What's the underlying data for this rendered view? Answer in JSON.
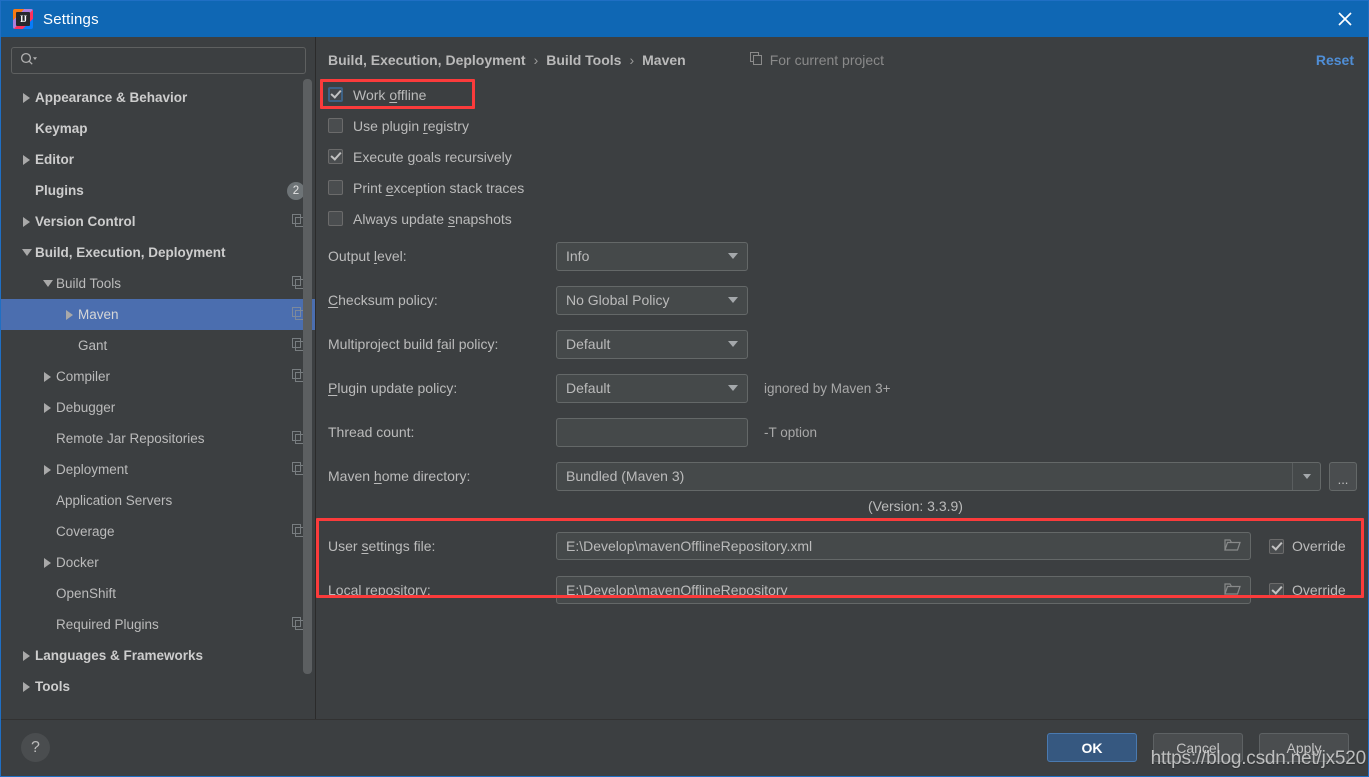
{
  "window": {
    "title": "Settings",
    "logo_icon": "intellij-idea-icon",
    "close_icon": "close-icon",
    "accent_titlebar": "#0f67b4",
    "selection_color": "#4b6eaf",
    "annotation_color": "#fb3b3b"
  },
  "sidebar": {
    "search": {
      "placeholder": "",
      "value": "",
      "icon": "search-icon"
    },
    "items": [
      {
        "label": "Appearance & Behavior",
        "level": 0,
        "arrow": "collapsed",
        "scope_icon": false,
        "badge": null,
        "selected": false
      },
      {
        "label": "Keymap",
        "level": 0,
        "arrow": "none",
        "scope_icon": false,
        "badge": null,
        "selected": false
      },
      {
        "label": "Editor",
        "level": 0,
        "arrow": "collapsed",
        "scope_icon": false,
        "badge": null,
        "selected": false
      },
      {
        "label": "Plugins",
        "level": 0,
        "arrow": "none",
        "scope_icon": false,
        "badge": "2",
        "selected": false
      },
      {
        "label": "Version Control",
        "level": 0,
        "arrow": "collapsed",
        "scope_icon": true,
        "badge": null,
        "selected": false
      },
      {
        "label": "Build, Execution, Deployment",
        "level": 0,
        "arrow": "expanded",
        "scope_icon": false,
        "badge": null,
        "selected": false
      },
      {
        "label": "Build Tools",
        "level": 1,
        "arrow": "expanded",
        "scope_icon": true,
        "badge": null,
        "selected": false
      },
      {
        "label": "Maven",
        "level": 2,
        "arrow": "collapsed",
        "scope_icon": true,
        "badge": null,
        "selected": true
      },
      {
        "label": "Gant",
        "level": 2,
        "arrow": "none",
        "scope_icon": true,
        "badge": null,
        "selected": false
      },
      {
        "label": "Compiler",
        "level": 1,
        "arrow": "collapsed",
        "scope_icon": true,
        "badge": null,
        "selected": false
      },
      {
        "label": "Debugger",
        "level": 1,
        "arrow": "collapsed",
        "scope_icon": false,
        "badge": null,
        "selected": false
      },
      {
        "label": "Remote Jar Repositories",
        "level": 1,
        "arrow": "none",
        "scope_icon": true,
        "badge": null,
        "selected": false
      },
      {
        "label": "Deployment",
        "level": 1,
        "arrow": "collapsed",
        "scope_icon": true,
        "badge": null,
        "selected": false
      },
      {
        "label": "Application Servers",
        "level": 1,
        "arrow": "none",
        "scope_icon": false,
        "badge": null,
        "selected": false
      },
      {
        "label": "Coverage",
        "level": 1,
        "arrow": "none",
        "scope_icon": true,
        "badge": null,
        "selected": false
      },
      {
        "label": "Docker",
        "level": 1,
        "arrow": "collapsed",
        "scope_icon": false,
        "badge": null,
        "selected": false
      },
      {
        "label": "OpenShift",
        "level": 1,
        "arrow": "none",
        "scope_icon": false,
        "badge": null,
        "selected": false
      },
      {
        "label": "Required Plugins",
        "level": 1,
        "arrow": "none",
        "scope_icon": true,
        "badge": null,
        "selected": false
      },
      {
        "label": "Languages & Frameworks",
        "level": 0,
        "arrow": "collapsed",
        "scope_icon": false,
        "badge": null,
        "selected": false
      },
      {
        "label": "Tools",
        "level": 0,
        "arrow": "collapsed",
        "scope_icon": false,
        "badge": null,
        "selected": false
      }
    ]
  },
  "header": {
    "breadcrumb": [
      "Build, Execution, Deployment",
      "Build Tools",
      "Maven"
    ],
    "separator": "›",
    "for_current_project": "For current project",
    "for_current_project_icon": "project-scope-icon",
    "reset_label": "Reset"
  },
  "main": {
    "checkboxes": [
      {
        "label_before": "Work ",
        "mnemonic": "o",
        "label_after": "ffline",
        "checked": true,
        "focused": true
      },
      {
        "label_before": "Use plugin ",
        "mnemonic": "r",
        "label_after": "egistry",
        "checked": false,
        "focused": false
      },
      {
        "label_before": "Execute ",
        "mnemonic": "g",
        "label_after": "oals recursively",
        "checked": true,
        "focused": false
      },
      {
        "label_before": "Print ",
        "mnemonic": "e",
        "label_after": "xception stack traces",
        "checked": false,
        "focused": false
      },
      {
        "label_before": "Always update ",
        "mnemonic": "s",
        "label_after": "napshots",
        "checked": false,
        "focused": false
      }
    ],
    "combos": [
      {
        "label_before": "Output ",
        "mnemonic": "l",
        "label_after": "evel:",
        "value": "Info",
        "hint": ""
      },
      {
        "label_before": "",
        "mnemonic": "C",
        "label_after": "hecksum policy:",
        "value": "No Global Policy",
        "hint": ""
      },
      {
        "label_before": "Multiproject build ",
        "mnemonic": "f",
        "label_after": "ail policy:",
        "value": "Default",
        "hint": ""
      },
      {
        "label_before": "",
        "mnemonic": "P",
        "label_after": "lugin update policy:",
        "value": "Default",
        "hint": "ignored by Maven 3+"
      }
    ],
    "thread_count": {
      "label": "Thread count:",
      "value": "",
      "hint": "-T option"
    },
    "maven_home": {
      "label_before": "Maven ",
      "mnemonic": "h",
      "label_after": "ome directory:",
      "value": "Bundled (Maven 3)",
      "browse_label": "...",
      "version_note": "(Version: 3.3.9)"
    },
    "paths": [
      {
        "label_before": "User ",
        "mnemonic": "s",
        "label_after": "ettings file:",
        "value": "E:\\Develop\\mavenOfflineRepository.xml",
        "folder_icon": "folder-icon",
        "override_label": "Override",
        "override_checked": true
      },
      {
        "label_before": "Local ",
        "mnemonic": "r",
        "label_after": "epository:",
        "value": "E:\\Develop\\mavenOfflineRepository",
        "folder_icon": "folder-icon",
        "override_label": "Override",
        "override_checked": true
      }
    ]
  },
  "footer": {
    "help_label": "?",
    "ok_label": "OK",
    "cancel_label": "Cancel",
    "apply_label": "Apply"
  },
  "watermark": "https://blog.csdn.net/jx520"
}
